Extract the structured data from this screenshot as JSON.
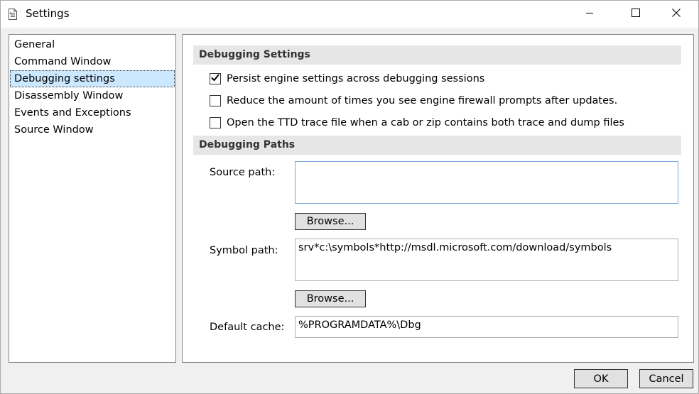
{
  "window": {
    "title": "Settings",
    "icons": {
      "app": "settings-document-icon",
      "minimize": "minimize-icon",
      "maximize": "maximize-icon",
      "close": "close-icon"
    }
  },
  "sidebar": {
    "items": [
      {
        "label": "General"
      },
      {
        "label": "Command Window"
      },
      {
        "label": "Debugging settings"
      },
      {
        "label": "Disassembly Window"
      },
      {
        "label": "Events and Exceptions"
      },
      {
        "label": "Source Window"
      }
    ],
    "selected": "Debugging settings"
  },
  "debugging_settings": {
    "header": "Debugging Settings",
    "options": [
      {
        "label": "Persist engine settings across debugging sessions",
        "checked": true
      },
      {
        "label": "Reduce the amount of times you see engine firewall prompts after updates.",
        "checked": false
      },
      {
        "label": "Open the TTD trace file when a cab or zip contains both trace and dump files",
        "checked": false
      }
    ]
  },
  "debugging_paths": {
    "header": "Debugging Paths",
    "source_path": {
      "label": "Source path:",
      "value": "",
      "browse_label": "Browse..."
    },
    "symbol_path": {
      "label": "Symbol path:",
      "value": "srv*c:\\symbols*http://msdl.microsoft.com/download/symbols",
      "browse_label": "Browse..."
    },
    "default_cache": {
      "label": "Default cache:",
      "value": "%PROGRAMDATA%\\Dbg"
    }
  },
  "footer": {
    "ok_label": "OK",
    "cancel_label": "Cancel"
  }
}
